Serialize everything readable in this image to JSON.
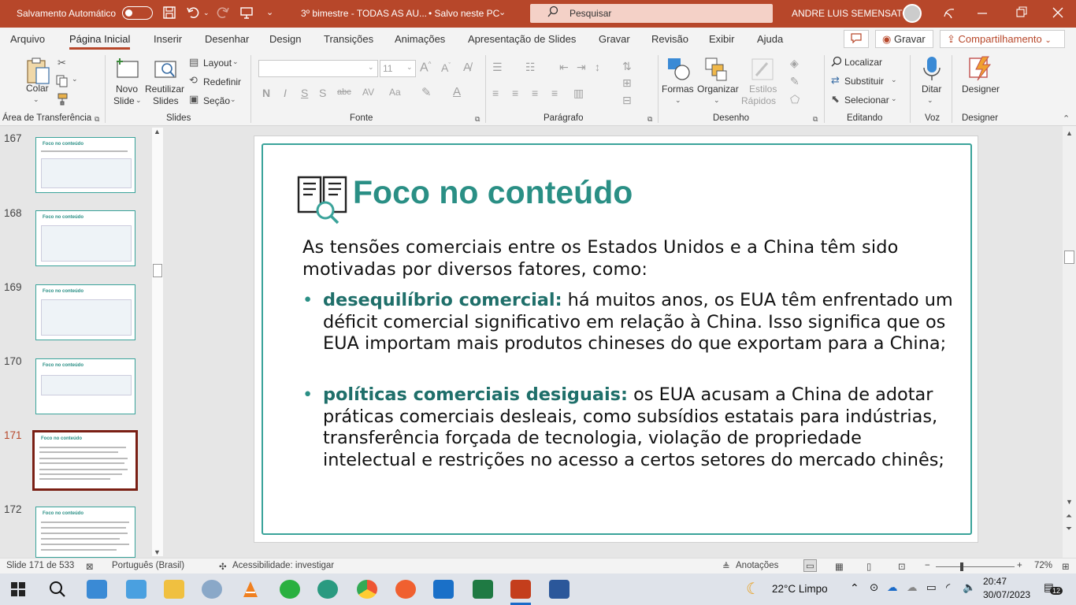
{
  "titlebar": {
    "autosave_label": "Salvamento Automático",
    "doc_title": "3º bimestre - TODAS AS AU...",
    "save_status": "• Salvo neste PC",
    "search_placeholder": "Pesquisar",
    "user_name": "ANDRE LUIS SEMENSATO",
    "accent_color": "#b7472a"
  },
  "menu": {
    "tabs": [
      "Arquivo",
      "Página Inicial",
      "Inserir",
      "Desenhar",
      "Design",
      "Transições",
      "Animações",
      "Apresentação de Slides",
      "Gravar",
      "Revisão",
      "Exibir",
      "Ajuda"
    ],
    "active_tab": "Página Inicial",
    "record_button": "Gravar",
    "share_button": "Compartilhamento"
  },
  "ribbon": {
    "clipboard": {
      "paste": "Colar",
      "group": "Área de Transferência"
    },
    "slides": {
      "new_slide_1": "Novo",
      "new_slide_2": "Slide",
      "reuse_1": "Reutilizar",
      "reuse_2": "Slides",
      "layout": "Layout",
      "reset": "Redefinir",
      "section": "Seção",
      "group": "Slides"
    },
    "font": {
      "size": "11",
      "group": "Fonte",
      "bold": "N",
      "italic": "I",
      "underline": "S"
    },
    "paragraph": {
      "group": "Parágrafo"
    },
    "drawing": {
      "shapes": "Formas",
      "arrange": "Organizar",
      "styles_1": "Estilos",
      "styles_2": "Rápidos",
      "group": "Desenho"
    },
    "editing": {
      "find": "Localizar",
      "replace": "Substituir",
      "select": "Selecionar",
      "group": "Editando"
    },
    "voice": {
      "dictate": "Ditar",
      "group": "Voz"
    },
    "designer": {
      "label": "Designer",
      "group": "Designer"
    }
  },
  "panel": {
    "slides": [
      {
        "num": "167",
        "title": "Foco no conteúdo"
      },
      {
        "num": "168",
        "title": "Foco no conteúdo"
      },
      {
        "num": "169",
        "title": "Foco no conteúdo"
      },
      {
        "num": "170",
        "title": "Foco no conteúdo"
      },
      {
        "num": "171",
        "title": "Foco no conteúdo"
      },
      {
        "num": "172",
        "title": "Foco no conteúdo"
      }
    ],
    "selected": "171"
  },
  "slide": {
    "title": "Foco no conteúdo",
    "intro": "As tensões comerciais entre os Estados Unidos e a China têm sido motivadas por diversos fatores, como:",
    "bullets": [
      {
        "term": "desequilíbrio comercial",
        "colon": ":",
        "text": " há muitos anos, os EUA têm enfrentado um déficit comercial significativo em relação à China. Isso significa que os EUA importam mais produtos chineses do que exportam para a China;"
      },
      {
        "term": "políticas comerciais desiguais",
        "colon": ":",
        "text": " os EUA acusam a China de adotar práticas comerciais desleais, como subsídios estatais para indústrias, transferência forçada de tecnologia, violação de propriedade intelectual e restrições no acesso a certos setores do mercado chinês;"
      }
    ],
    "accent_color": "#2a8f85"
  },
  "status": {
    "slide_info": "Slide 171 de 533",
    "language": "Português (Brasil)",
    "accessibility": "Acessibilidade: investigar",
    "notes": "Anotações",
    "zoom": "72%"
  },
  "taskbar": {
    "weather": "22°C  Limpo",
    "time": "20:47",
    "date": "30/07/2023",
    "notifications": "12"
  }
}
